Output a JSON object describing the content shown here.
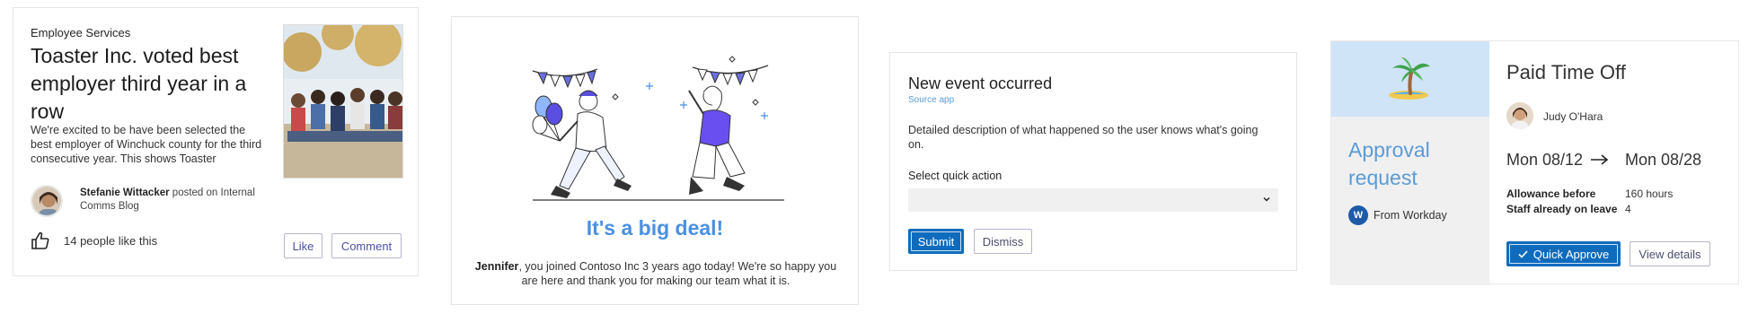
{
  "news_card": {
    "category": "Employee Services",
    "headline": "Toaster Inc. voted best employer third year in a row",
    "body": "We're excited to be have been selected the best employer of Winchuck county for the third consecutive year. This shows Toaster",
    "author_name": "Stefanie Wittacker",
    "author_suffix": " posted on Internal Comms Blog",
    "likes_text": "14 people like this",
    "like_label": "Like",
    "comment_label": "Comment"
  },
  "celebration_card": {
    "title": "It's a big deal!",
    "message_name": "Jennifer",
    "message_rest": ", you joined Contoso Inc 3 years ago today! We're so happy you are here and thank you for making our team what it is."
  },
  "event_card": {
    "title": "New event occurred",
    "source": "Source app",
    "description": "Detailed description of what happened so the user knows what's going on.",
    "select_label": "Select quick action",
    "select_value": "",
    "submit_label": "Submit",
    "dismiss_label": "Dismiss"
  },
  "approval_card": {
    "heading": "Approval request",
    "source_label": "From Workday",
    "source_icon_letter": "W",
    "title": "Paid Time Off",
    "person": "Judy O'Hara",
    "date_from": "Mon 08/12",
    "date_to": "Mon 08/28",
    "facts": [
      {
        "key": "Allowance before",
        "value": "160 hours"
      },
      {
        "key": "Staff already on leave",
        "value": "4"
      }
    ],
    "approve_label": "Quick Approve",
    "details_label": "View details"
  },
  "colors": {
    "accent_blue": "#0f6cbd",
    "celebration_blue": "#4a90e2",
    "approval_header_bg": "#cfe4f7",
    "outline_button_text": "#4b4fa6"
  }
}
